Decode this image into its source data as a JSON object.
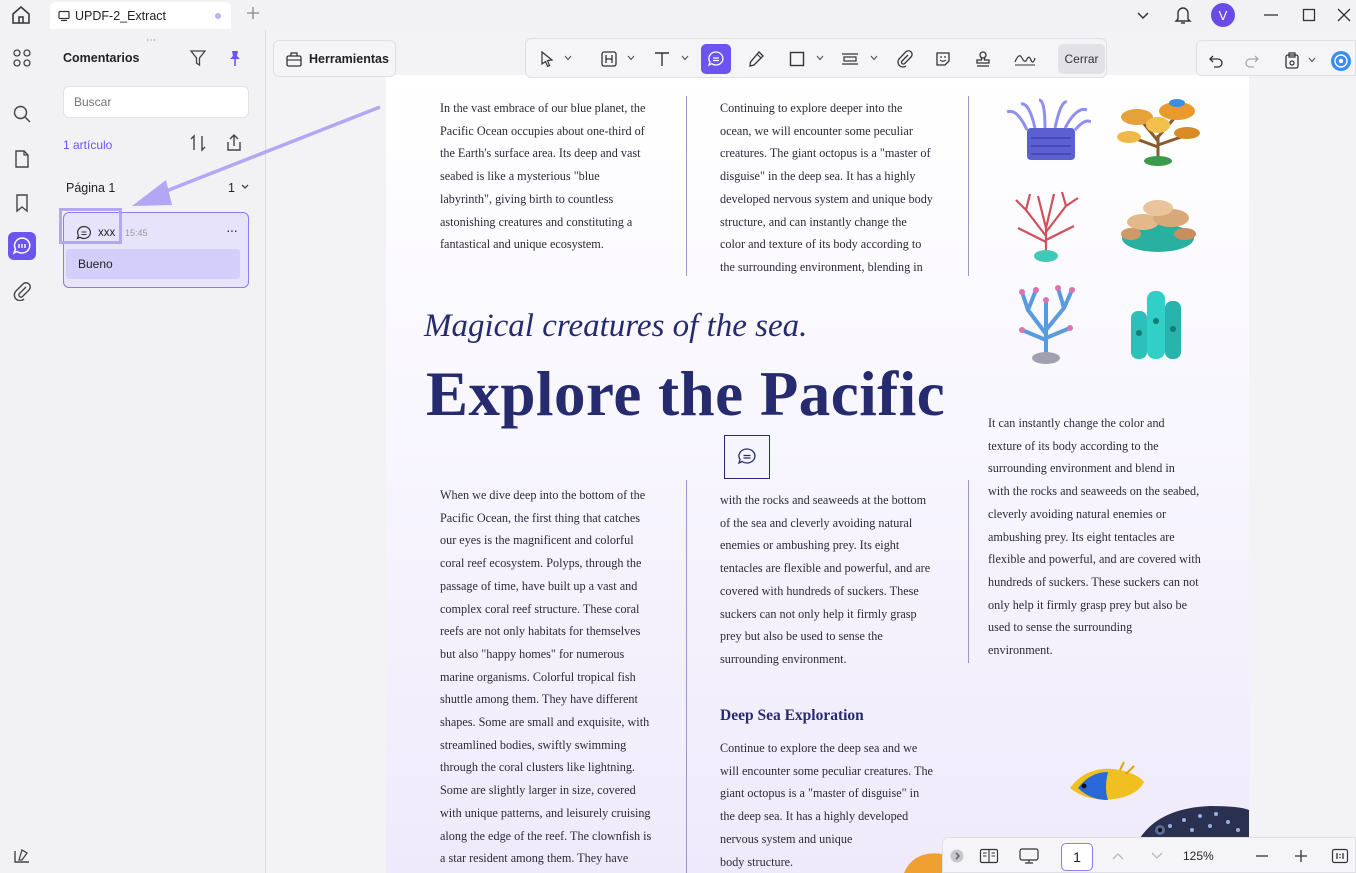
{
  "titlebar": {
    "tab_title": "UPDF-2_Extract",
    "avatar_letter": "V"
  },
  "panel": {
    "grip": "⋯",
    "title": "Comentarios",
    "search_placeholder": "Buscar",
    "count": "1 artículo",
    "page_label": "Página 1",
    "page_count": "1",
    "comment": {
      "user": "xxx",
      "time": "15:45",
      "more": "···",
      "body": "Bueno"
    }
  },
  "toolbar": {
    "tools_label": "Herramientas",
    "close_label": "Cerrar"
  },
  "document": {
    "col1_top": [
      "In the vast embrace of our blue planet, the",
      "Pacific Ocean occupies about one-third of",
      "the Earth's surface area. Its deep and vast",
      "seabed is like a mysterious \"blue",
      "labyrinth\", giving birth to countless",
      "astonishing creatures and constituting a",
      "fantastical and unique ecosystem."
    ],
    "col2_top": [
      "Continuing to explore deeper into the",
      "ocean, we will encounter some peculiar",
      "creatures. The giant octopus is a \"master of",
      "disguise\" in the deep sea. It has a highly",
      "developed nervous system and unique body",
      "structure, and can instantly change the",
      "color and texture of its body according to",
      "the surrounding environment, blending in"
    ],
    "subtitle": "Magical creatures of the sea.",
    "headline": "Explore the Pacific",
    "col3": [
      "It can instantly change the color and",
      "texture of its body according to the",
      "surrounding environment and blend in",
      "with the rocks and seaweeds on the seabed,",
      "cleverly avoiding natural enemies or",
      "ambushing prey. Its eight tentacles are",
      "flexible and powerful, and are covered with",
      "hundreds of suckers. These suckers can not",
      "only help it firmly grasp prey but also be",
      "used to sense the surrounding",
      "environment."
    ],
    "col1_bottom": [
      "When we dive deep into the bottom of the",
      "Pacific Ocean, the first thing that catches",
      "our eyes is the magnificent and colorful",
      "coral reef ecosystem. Polyps, through the",
      "passage of time, have built up a vast and",
      "complex coral reef structure. These coral",
      "reefs are not only habitats for themselves",
      "but also \"happy homes\" for numerous",
      "marine organisms. Colorful tropical fish",
      "shuttle among them. They have different",
      "shapes. Some are small and exquisite, with",
      "streamlined bodies, swiftly swimming",
      "through the coral clusters like lightning.",
      "Some are slightly larger in size, covered",
      "with unique patterns, and leisurely cruising",
      "along the edge of the reef. The clownfish is",
      "a star resident among them. They have"
    ],
    "col2_mid": [
      "with the rocks and seaweeds at the bottom",
      "of the sea and cleverly avoiding natural",
      "enemies or ambushing prey. Its eight",
      "tentacles are flexible and powerful, and are",
      "covered with hundreds of suckers. These",
      "suckers can not only help it firmly grasp",
      "prey but also be used to sense the",
      "surrounding environment."
    ],
    "section_title": "Deep Sea Exploration",
    "col2_bottom": [
      "Continue to explore the deep sea and we",
      "will encounter some peculiar creatures. The",
      "giant octopus is a \"master of disguise\" in",
      "the deep sea. It has a highly developed",
      "nervous system and unique",
      "body structure."
    ]
  },
  "bottombar": {
    "page_number": "1",
    "zoom": "125%"
  },
  "colors": {
    "accent": "#6c54ef",
    "heading": "#262a6e",
    "card_bg": "#e6e3fb",
    "arrow": "#b3a7f5"
  }
}
